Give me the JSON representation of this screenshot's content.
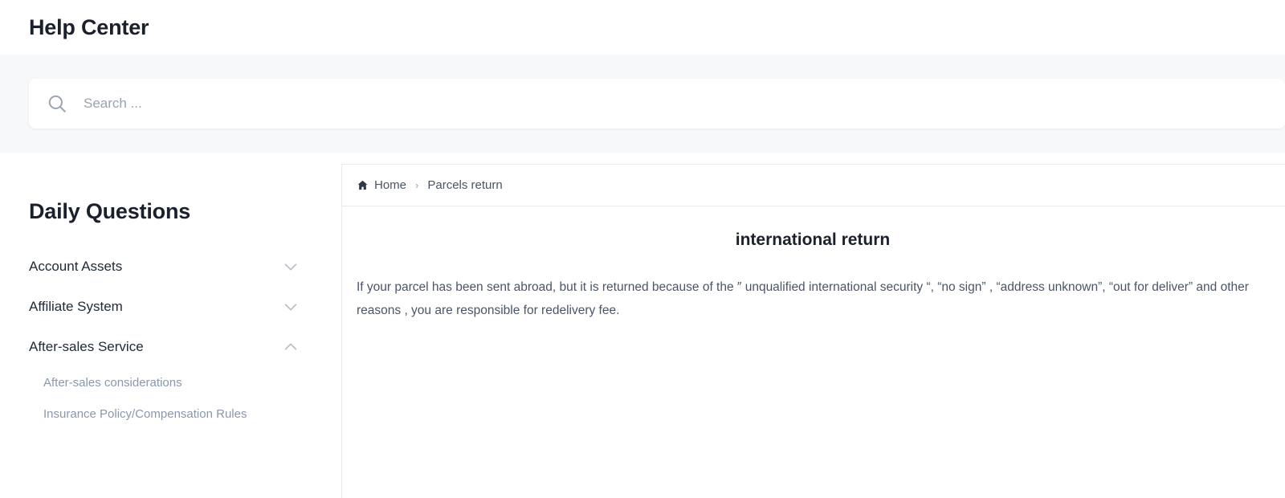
{
  "header": {
    "title": "Help Center"
  },
  "search": {
    "placeholder": "Search ...",
    "value": "",
    "icon": "search-icon"
  },
  "sidebar": {
    "title": "Daily Questions",
    "items": [
      {
        "label": "Account Assets",
        "expanded": false,
        "icon": "chevron-down-icon",
        "children": []
      },
      {
        "label": "Affiliate System",
        "expanded": false,
        "icon": "chevron-down-icon",
        "children": []
      },
      {
        "label": "After-sales Service",
        "expanded": true,
        "icon": "chevron-up-icon",
        "children": [
          {
            "label": "After-sales considerations"
          },
          {
            "label": "Insurance Policy/Compensation Rules"
          }
        ]
      }
    ]
  },
  "breadcrumb": {
    "home_icon": "home-icon",
    "home_label": "Home",
    "separator": "›",
    "current_label": "Parcels return"
  },
  "article": {
    "title": "international return",
    "paragraph": "If your parcel has been sent abroad, but it is returned because of the ″ unqualified international security “, “no sign” , “address unknown”, “out for deliver” and other reasons , you are responsible for redelivery fee."
  },
  "colors": {
    "band_background": "#f7f8fa",
    "page_background": "#ffffff",
    "heading_text": "#1a202c",
    "body_text": "#4a5568",
    "muted_text": "#8a98ad",
    "border": "#e8eaee"
  }
}
